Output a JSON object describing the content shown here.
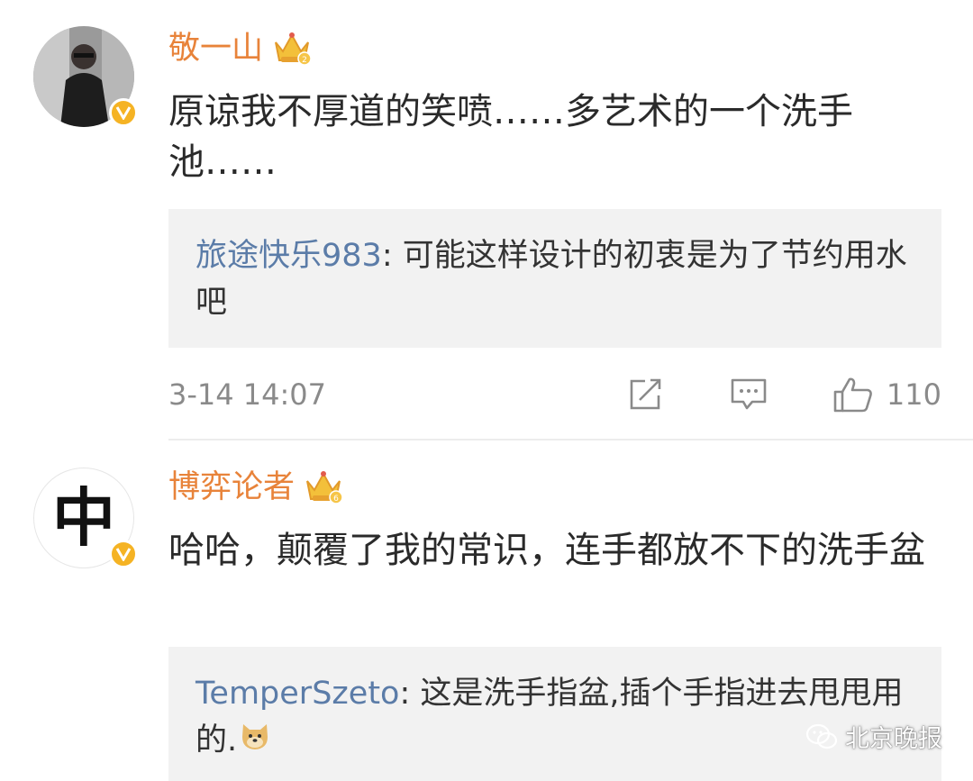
{
  "comments": [
    {
      "username": "敬一山",
      "content": "原谅我不厚道的笑喷……多艺术的一个洗手池……",
      "reply": {
        "user": "旅途快乐983",
        "separator": ": ",
        "text": "可能这样设计的初衷是为了节约用水吧"
      },
      "time": "3-14 14:07",
      "like_count": "110"
    },
    {
      "username": "博弈论者",
      "avatar_char": "中",
      "content": "哈哈，颠覆了我的常识，连手都放不下的洗手盆",
      "reply": {
        "user": "TemperSzeto",
        "separator": ": ",
        "text": "这是洗手指盆,插个手指进去甩甩用的."
      }
    }
  ],
  "watermark": "北京晚报",
  "icons": {
    "verified": "verified-v-icon",
    "vip": "crown-vip-icon",
    "repost": "repost-icon",
    "reply": "comment-icon",
    "like": "thumbs-up-icon",
    "emoji": "doge-emoji-icon",
    "wechat": "wechat-icon"
  },
  "colors": {
    "username": "#e8833a",
    "reply_user": "#5b7ca8",
    "verified": "#f5b324",
    "meta": "#8a8a8a",
    "reply_bg": "#f2f2f2"
  }
}
